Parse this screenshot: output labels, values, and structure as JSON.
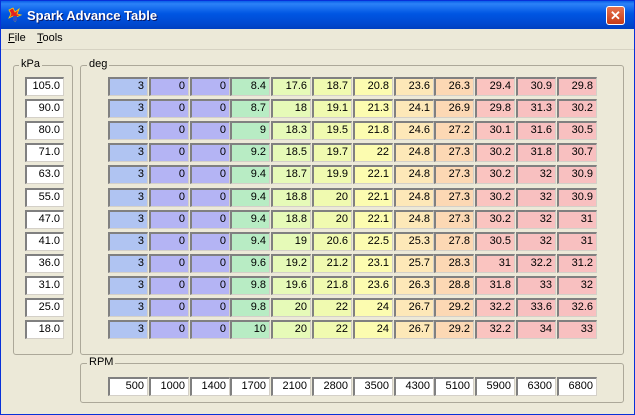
{
  "window": {
    "title": "Spark Advance Table",
    "close_glyph": "✕",
    "icon": "spark-plug-icon"
  },
  "menu": [
    "File",
    "Tools"
  ],
  "kpa_group": {
    "label": "kPa",
    "values": [
      "105.0",
      "90.0",
      "80.0",
      "71.0",
      "63.0",
      "55.0",
      "47.0",
      "41.0",
      "36.0",
      "31.0",
      "25.0",
      "18.0"
    ]
  },
  "deg_group": {
    "label": "deg",
    "column_colors": [
      "#b0c4f2",
      "#b4b4f4",
      "#b4b4f4",
      "#b8ecc4",
      "#e6fab8",
      "#f0fab0",
      "#fcfcb0",
      "#fde8b8",
      "#fcd8b4",
      "#fac4c0",
      "#f8c0c0",
      "#f8c0c0"
    ],
    "rows": [
      [
        "3",
        "0",
        "0",
        "8.4",
        "17.6",
        "18.7",
        "20.8",
        "23.6",
        "26.3",
        "29.4",
        "30.9",
        "29.8"
      ],
      [
        "3",
        "0",
        "0",
        "8.7",
        "18",
        "19.1",
        "21.3",
        "24.1",
        "26.9",
        "29.8",
        "31.3",
        "30.2"
      ],
      [
        "3",
        "0",
        "0",
        "9",
        "18.3",
        "19.5",
        "21.8",
        "24.6",
        "27.2",
        "30.1",
        "31.6",
        "30.5"
      ],
      [
        "3",
        "0",
        "0",
        "9.2",
        "18.5",
        "19.7",
        "22",
        "24.8",
        "27.3",
        "30.2",
        "31.8",
        "30.7"
      ],
      [
        "3",
        "0",
        "0",
        "9.4",
        "18.7",
        "19.9",
        "22.1",
        "24.8",
        "27.3",
        "30.2",
        "32",
        "30.9"
      ],
      [
        "3",
        "0",
        "0",
        "9.4",
        "18.8",
        "20",
        "22.1",
        "24.8",
        "27.3",
        "30.2",
        "32",
        "30.9"
      ],
      [
        "3",
        "0",
        "0",
        "9.4",
        "18.8",
        "20",
        "22.1",
        "24.8",
        "27.3",
        "30.2",
        "32",
        "31"
      ],
      [
        "3",
        "0",
        "0",
        "9.4",
        "19",
        "20.6",
        "22.5",
        "25.3",
        "27.8",
        "30.5",
        "32",
        "31"
      ],
      [
        "3",
        "0",
        "0",
        "9.6",
        "19.2",
        "21.2",
        "23.1",
        "25.7",
        "28.3",
        "31",
        "32.2",
        "31.2"
      ],
      [
        "3",
        "0",
        "0",
        "9.8",
        "19.6",
        "21.8",
        "23.6",
        "26.3",
        "28.8",
        "31.8",
        "33",
        "32"
      ],
      [
        "3",
        "0",
        "0",
        "9.8",
        "20",
        "22",
        "24",
        "26.7",
        "29.2",
        "32.2",
        "33.6",
        "32.6"
      ],
      [
        "3",
        "0",
        "0",
        "10",
        "20",
        "22",
        "24",
        "26.7",
        "29.2",
        "32.2",
        "34",
        "33"
      ]
    ]
  },
  "rpm_group": {
    "label": "RPM",
    "values": [
      "500",
      "1000",
      "1400",
      "1700",
      "2100",
      "2800",
      "3500",
      "4300",
      "5100",
      "5900",
      "6300",
      "6800"
    ]
  }
}
